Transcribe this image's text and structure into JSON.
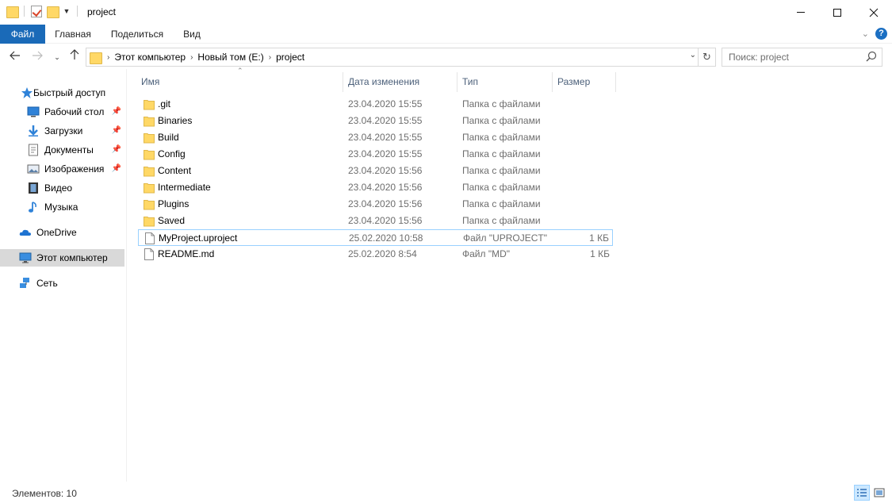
{
  "window": {
    "title": "project"
  },
  "ribbon": {
    "tabs": [
      "Файл",
      "Главная",
      "Поделиться",
      "Вид"
    ]
  },
  "address": {
    "crumbs": [
      "Этот компьютер",
      "Новый том (E:)",
      "project"
    ]
  },
  "search": {
    "placeholder": "Поиск: project"
  },
  "nav": {
    "quick_access": "Быстрый доступ",
    "items": [
      {
        "label": "Рабочий стол",
        "pinned": true
      },
      {
        "label": "Загрузки",
        "pinned": true
      },
      {
        "label": "Документы",
        "pinned": true
      },
      {
        "label": "Изображения",
        "pinned": true
      },
      {
        "label": "Видео",
        "pinned": false
      },
      {
        "label": "Музыка",
        "pinned": false
      }
    ],
    "onedrive": "OneDrive",
    "this_pc": "Этот компьютер",
    "network": "Сеть"
  },
  "columns": {
    "name": "Имя",
    "date": "Дата изменения",
    "type": "Тип",
    "size": "Размер"
  },
  "files": [
    {
      "name": ".git",
      "date": "23.04.2020 15:55",
      "type": "Папка с файлами",
      "size": "",
      "kind": "folder"
    },
    {
      "name": "Binaries",
      "date": "23.04.2020 15:55",
      "type": "Папка с файлами",
      "size": "",
      "kind": "folder"
    },
    {
      "name": "Build",
      "date": "23.04.2020 15:55",
      "type": "Папка с файлами",
      "size": "",
      "kind": "folder"
    },
    {
      "name": "Config",
      "date": "23.04.2020 15:55",
      "type": "Папка с файлами",
      "size": "",
      "kind": "folder"
    },
    {
      "name": "Content",
      "date": "23.04.2020 15:56",
      "type": "Папка с файлами",
      "size": "",
      "kind": "folder"
    },
    {
      "name": "Intermediate",
      "date": "23.04.2020 15:56",
      "type": "Папка с файлами",
      "size": "",
      "kind": "folder"
    },
    {
      "name": "Plugins",
      "date": "23.04.2020 15:56",
      "type": "Папка с файлами",
      "size": "",
      "kind": "folder"
    },
    {
      "name": "Saved",
      "date": "23.04.2020 15:56",
      "type": "Папка с файлами",
      "size": "",
      "kind": "folder"
    },
    {
      "name": "MyProject.uproject",
      "date": "25.02.2020 10:58",
      "type": "Файл \"UPROJECT\"",
      "size": "1 КБ",
      "kind": "file"
    },
    {
      "name": "README.md",
      "date": "25.02.2020 8:54",
      "type": "Файл \"MD\"",
      "size": "1 КБ",
      "kind": "file"
    }
  ],
  "status": {
    "items_count": "Элементов: 10"
  },
  "colors": {
    "file_tab": "#1a6ab8",
    "folder": "#ffd866",
    "selection_border": "#99d1ff",
    "column_header": "#4c607a"
  }
}
